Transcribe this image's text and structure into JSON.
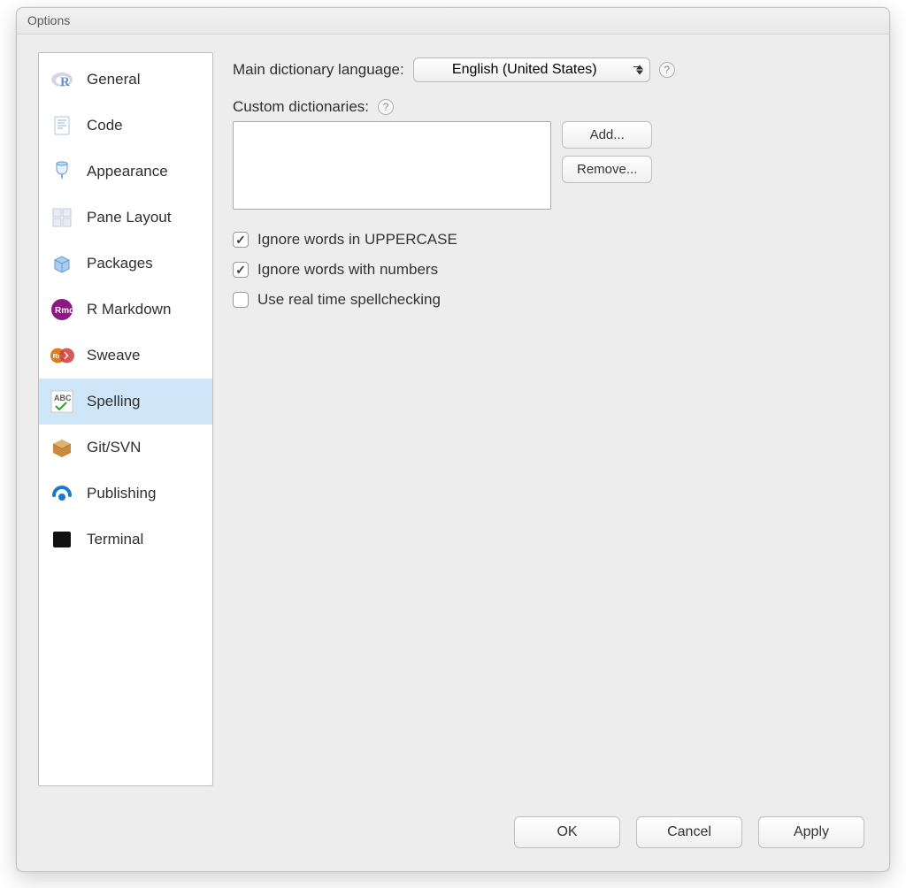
{
  "window": {
    "title": "Options"
  },
  "sidebar": {
    "items": [
      {
        "label": "General",
        "icon": "r-logo-icon"
      },
      {
        "label": "Code",
        "icon": "code-file-icon"
      },
      {
        "label": "Appearance",
        "icon": "paint-bucket-icon"
      },
      {
        "label": "Pane Layout",
        "icon": "panes-icon"
      },
      {
        "label": "Packages",
        "icon": "package-box-icon"
      },
      {
        "label": "R Markdown",
        "icon": "rmd-icon"
      },
      {
        "label": "Sweave",
        "icon": "sweave-icon"
      },
      {
        "label": "Spelling",
        "icon": "spellcheck-icon",
        "selected": true
      },
      {
        "label": "Git/SVN",
        "icon": "git-box-icon"
      },
      {
        "label": "Publishing",
        "icon": "publish-icon"
      },
      {
        "label": "Terminal",
        "icon": "terminal-icon"
      }
    ]
  },
  "main": {
    "language_label": "Main dictionary language:",
    "language_value": "English (United States)",
    "custom_dict_label": "Custom dictionaries:",
    "add_button": "Add...",
    "remove_button": "Remove...",
    "checks": [
      {
        "label": "Ignore words in UPPERCASE",
        "checked": true
      },
      {
        "label": "Ignore words with numbers",
        "checked": true
      },
      {
        "label": "Use real time spellchecking",
        "checked": false
      }
    ]
  },
  "footer": {
    "ok": "OK",
    "cancel": "Cancel",
    "apply": "Apply"
  }
}
